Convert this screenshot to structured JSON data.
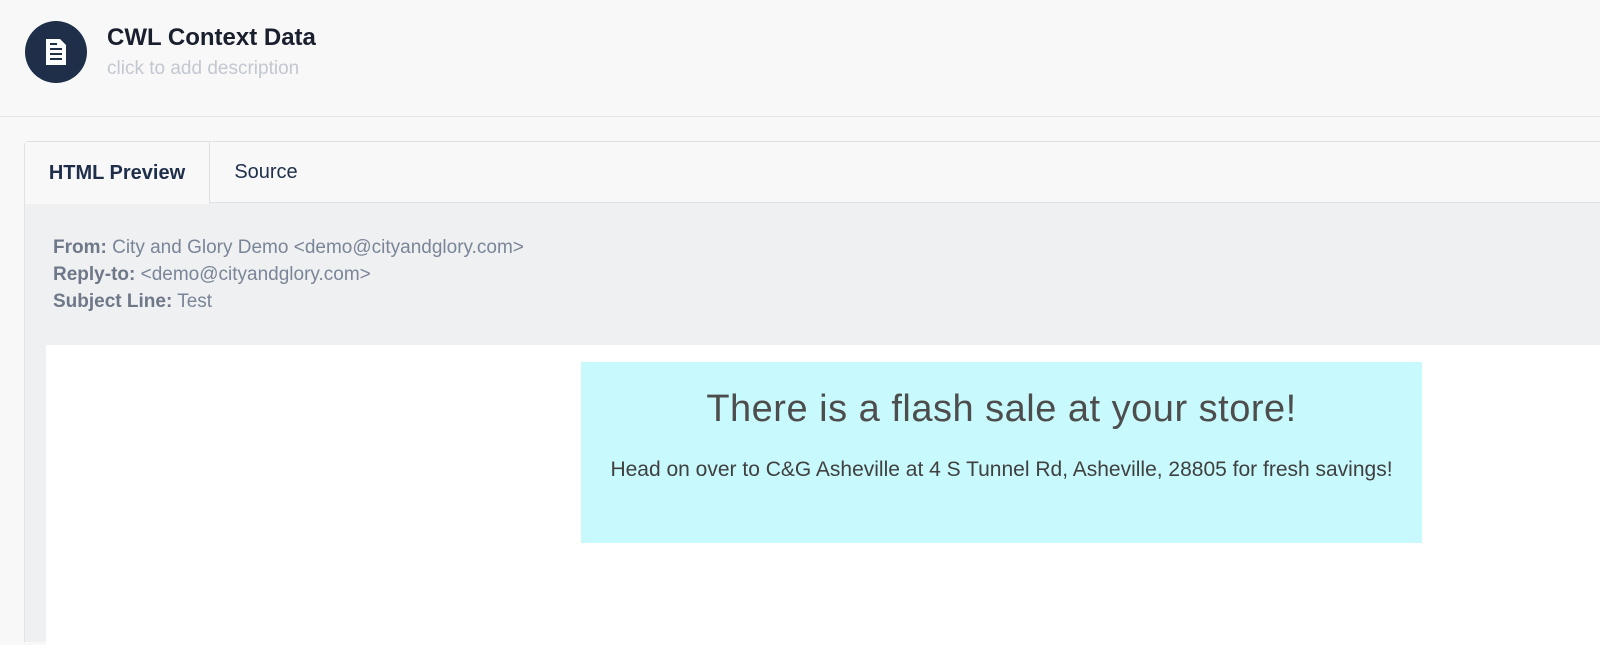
{
  "header": {
    "title": "CWL Context Data",
    "description_placeholder": "click to add description",
    "icon": "document-icon",
    "avatar_color": "#1f2f4a"
  },
  "tabs": [
    {
      "label": "HTML Preview",
      "active": true
    },
    {
      "label": "Source",
      "active": false
    }
  ],
  "email": {
    "from_label": "From:",
    "from_value": "City and Glory Demo <demo@cityandglory.com>",
    "reply_to_label": "Reply-to:",
    "reply_to_value": "<demo@cityandglory.com>",
    "subject_label": "Subject Line:",
    "subject_value": "Test"
  },
  "preview": {
    "banner_color": "#c8f9fc",
    "headline": "There is a flash sale at your store!",
    "body": "Head on over to C&G Asheville at 4 S Tunnel Rd, Asheville, 28805 for fresh savings!"
  }
}
